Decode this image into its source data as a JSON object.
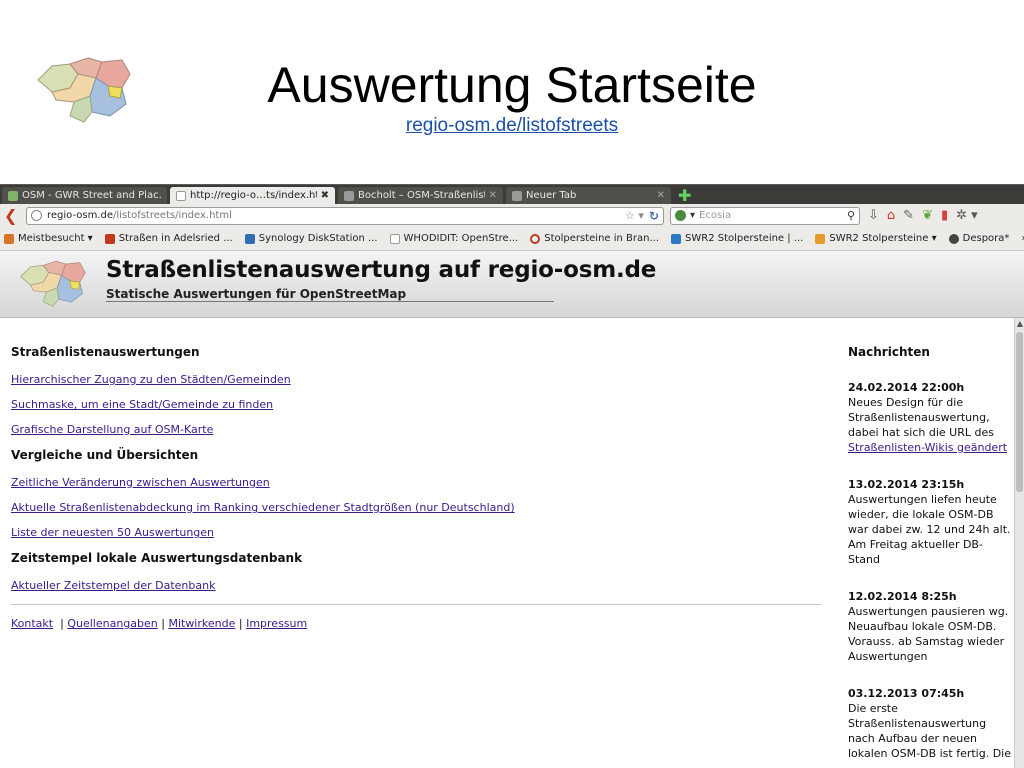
{
  "slide": {
    "title": "Auswertung Startseite",
    "link": "regio-osm.de/listofstreets"
  },
  "browser": {
    "tabs": [
      {
        "label": "OSM - GWR Street and Plac...",
        "icon_color": "#7fb36b",
        "active": false
      },
      {
        "label": "http://regio-o…ts/index.html",
        "icon_color": "#ffffff",
        "active": true
      },
      {
        "label": "Bocholt – OSM-Straßenliste...",
        "icon_color": "#9a9a9a",
        "active": false
      },
      {
        "label": "Neuer Tab",
        "icon_color": "#9a9a9a",
        "active": false
      }
    ],
    "url": {
      "host": "regio-osm.de",
      "path": "/listofstreets/index.html"
    },
    "search_placeholder": "Ecosia",
    "bookmarks": [
      {
        "label": "Meistbesucht ▾",
        "icon_color": "#d8742a"
      },
      {
        "label": "Straßen in Adelsried ...",
        "icon_color": "#c2371d"
      },
      {
        "label": "Synology DiskStation ...",
        "icon_color": "#2f6db5"
      },
      {
        "label": "WHODIDIT: OpenStre...",
        "icon_color": "#ffffff"
      },
      {
        "label": "Stolpersteine in Bran...",
        "icon_color": "#c2371d"
      },
      {
        "label": "SWR2 Stolpersteine | ...",
        "icon_color": "#2a7ac4"
      },
      {
        "label": "SWR2 Stolpersteine ▾",
        "icon_color": "#e59a2a"
      },
      {
        "label": "Despora*",
        "icon_color": "#444444"
      }
    ],
    "bookmarks_more": "»"
  },
  "site": {
    "title": "Straßenlistenauswertung auf regio-osm.de",
    "subtitle": "Statische Auswertungen für OpenStreetMap"
  },
  "main": {
    "section1": {
      "heading": "Straßenlistenauswertungen",
      "links": [
        "Hierarchischer Zugang zu den Städten/Gemeinden",
        "Suchmaske, um eine Stadt/Gemeinde zu finden",
        "Grafische Darstellung auf OSM-Karte"
      ]
    },
    "section2": {
      "heading": "Vergleiche und Übersichten",
      "links": [
        "Zeitliche Veränderung zwischen Auswertungen",
        "Aktuelle Straßenlistenabdeckung im Ranking verschiedener Stadtgrößen (nur Deutschland)",
        "Liste der neuesten 50 Auswertungen"
      ]
    },
    "section3": {
      "heading": "Zeitstempel lokale Auswertungsdatenbank",
      "links": [
        "Aktueller Zeitstempel der Datenbank"
      ]
    },
    "footer": {
      "kontakt": "Kontakt",
      "quellen": "Quellenangaben",
      "mitwirkende": "Mitwirkende",
      "impressum": "Impressum",
      "sep": "|"
    }
  },
  "news": {
    "title": "Nachrichten",
    "items": [
      {
        "date": "24.02.2014 22:00h",
        "text": "Neues Design für die Straßenlistenauswertung, dabei hat sich die URL des",
        "link": "Straßenlisten-Wikis geändert"
      },
      {
        "date": "13.02.2014 23:15h",
        "text": "Auswertungen liefen heute wieder, die lokale OSM-DB war dabei zw. 12 und 24h alt. Am Freitag aktueller DB-Stand"
      },
      {
        "date": "12.02.2014 8:25h",
        "text": "Auswertungen pausieren wg. Neuaufbau lokale OSM-DB. Vorauss. ab Samstag wieder Auswertungen"
      },
      {
        "date": "03.12.2013 07:45h",
        "text": "Die erste Straßenlistenauswertung nach Aufbau der neuen lokalen OSM-DB ist fertig. Die"
      }
    ]
  }
}
